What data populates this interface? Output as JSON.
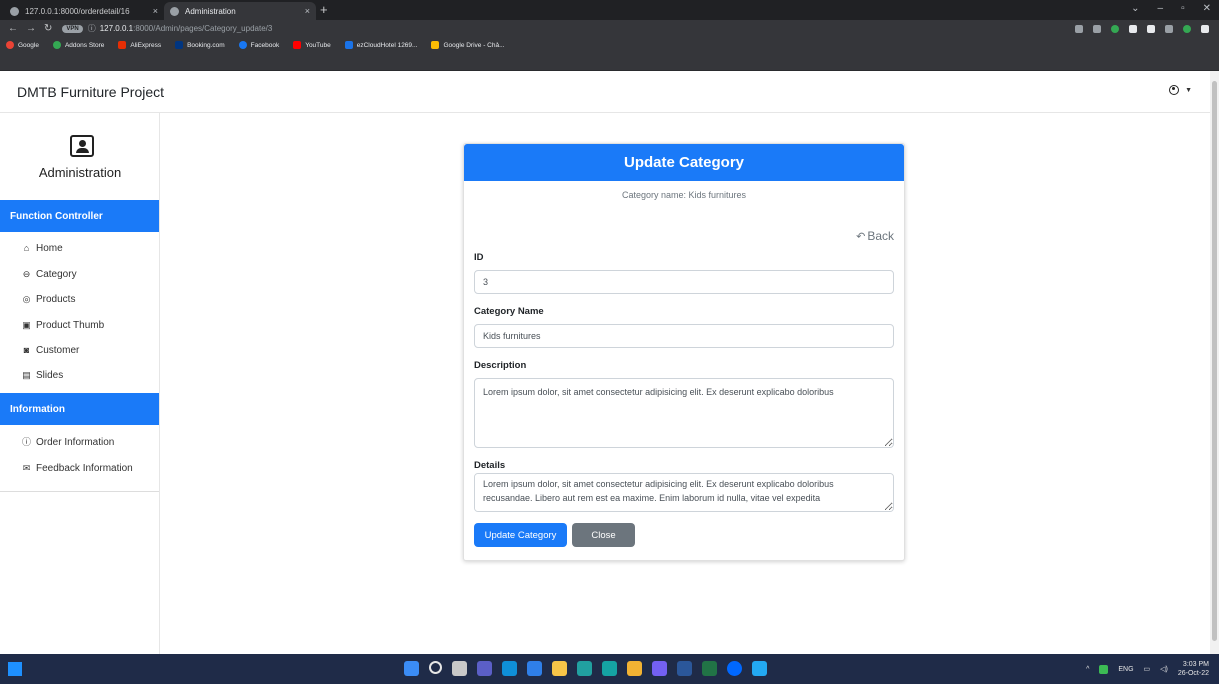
{
  "browser": {
    "tabs": [
      {
        "title": "127.0.0.1:8000/orderdetail/16",
        "close": "×"
      },
      {
        "title": "Administration",
        "close": "×"
      }
    ],
    "new_tab": "+",
    "address": {
      "vpn_badge": "VPN",
      "info_icon": "ⓘ",
      "host": "127.0.0.1",
      "path": ":8000/Admin/pages/Category_update/3"
    },
    "bookmarks": [
      {
        "label": "Google",
        "color": "#ea4335"
      },
      {
        "label": "Addons Store",
        "color": "#34a853"
      },
      {
        "label": "AliExpress",
        "color": "#e62e04"
      },
      {
        "label": "Booking.com",
        "color": "#003580"
      },
      {
        "label": "Facebook",
        "color": "#1877f2"
      },
      {
        "label": "YouTube",
        "color": "#ff0000"
      },
      {
        "label": "ezCloudHotel 1269...",
        "color": "#1a73e8"
      },
      {
        "label": "Google Drive - Chả...",
        "color": "#fbbc04"
      }
    ]
  },
  "navbar": {
    "brand": "DMTB Furniture Project"
  },
  "sidebar": {
    "title": "Administration",
    "function_header": "Function Controller",
    "function_items": [
      {
        "label": "Home",
        "icon": "home-icon"
      },
      {
        "label": "Category",
        "icon": "category-icon"
      },
      {
        "label": "Products",
        "icon": "products-icon"
      },
      {
        "label": "Product Thumb",
        "icon": "image-icon"
      },
      {
        "label": "Customer",
        "icon": "customer-icon"
      },
      {
        "label": "Slides",
        "icon": "slides-icon"
      }
    ],
    "info_header": "Information",
    "info_items": [
      {
        "label": "Order Information",
        "icon": "info-icon"
      },
      {
        "label": "Feedback Information",
        "icon": "feedback-icon"
      }
    ]
  },
  "form": {
    "header": "Update Category",
    "subtitle": "Category name: Kids furnitures",
    "back_label": "Back",
    "id_label": "ID",
    "id_value": "3",
    "name_label": "Category Name",
    "name_value": "Kids furnitures",
    "description_label": "Description",
    "description_value": "Lorem ipsum dolor, sit amet consectetur adipisicing elit. Ex deserunt explicabo doloribus",
    "details_label": "Details",
    "details_value": "Lorem ipsum dolor, sit amet consectetur adipisicing elit. Ex deserunt explicabo doloribus recusandae. Libero aut rem est ea maxime. Enim laborum id nulla, vitae vel expedita",
    "submit_label": "Update Category",
    "close_label": "Close"
  },
  "taskbar": {
    "language": "ENG",
    "time": "3:03 PM",
    "date": "26-Oct-22"
  }
}
